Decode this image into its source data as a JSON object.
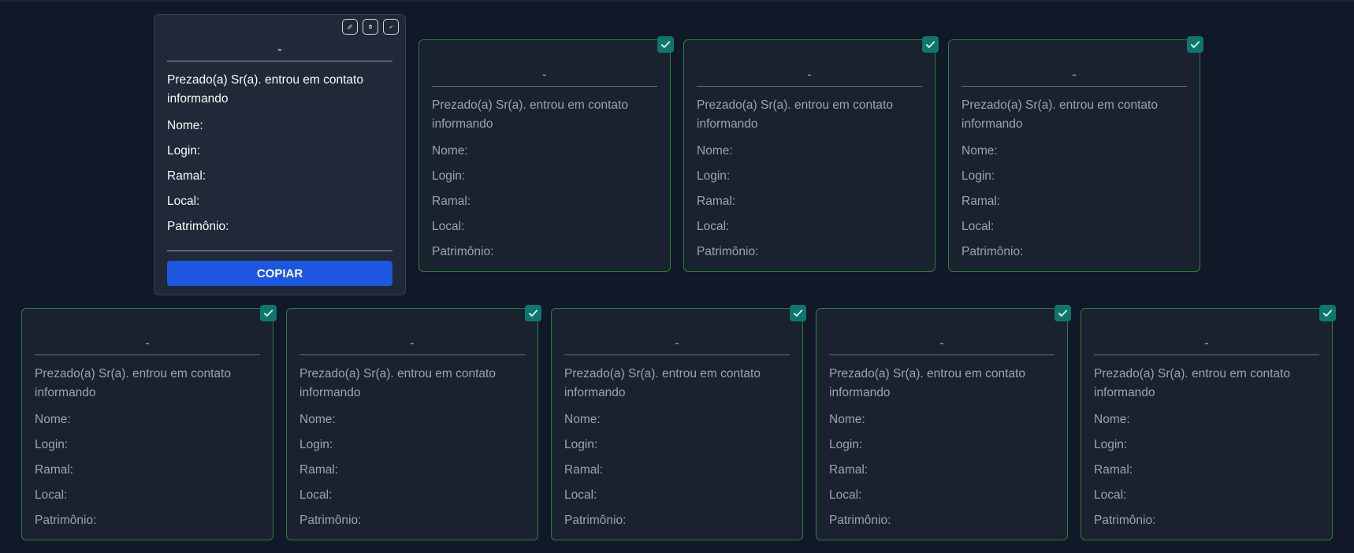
{
  "colors": {
    "background": "#111827",
    "card_active": "#1f2937",
    "card_done_border": "#2e7d32",
    "copy_button": "#1d56e0",
    "check_badge": "#0f766e"
  },
  "active_card": {
    "title": "-",
    "message": "Prezado(a) Sr(a). entrou em contato informando",
    "fields": [
      "Nome:",
      "Login:",
      "Ramal:",
      "Local:",
      "Patrimônio:"
    ],
    "copy_label": "COPIAR",
    "toolbar_icons": [
      "edit-icon",
      "trash-icon",
      "check-icon"
    ]
  },
  "done_cards": [
    {
      "title": "-",
      "message": "Prezado(a) Sr(a). entrou em contato informando",
      "fields": [
        "Nome:",
        "Login:",
        "Ramal:",
        "Local:",
        "Patrimônio:"
      ],
      "status": "checked"
    },
    {
      "title": "-",
      "message": "Prezado(a) Sr(a). entrou em contato informando",
      "fields": [
        "Nome:",
        "Login:",
        "Ramal:",
        "Local:",
        "Patrimônio:"
      ],
      "status": "checked"
    },
    {
      "title": "-",
      "message": "Prezado(a) Sr(a). entrou em contato informando",
      "fields": [
        "Nome:",
        "Login:",
        "Ramal:",
        "Local:",
        "Patrimônio:"
      ],
      "status": "checked"
    },
    {
      "title": "-",
      "message": "Prezado(a) Sr(a). entrou em contato informando",
      "fields": [
        "Nome:",
        "Login:",
        "Ramal:",
        "Local:",
        "Patrimônio:"
      ],
      "status": "checked"
    },
    {
      "title": "-",
      "message": "Prezado(a) Sr(a). entrou em contato informando",
      "fields": [
        "Nome:",
        "Login:",
        "Ramal:",
        "Local:",
        "Patrimônio:"
      ],
      "status": "checked"
    },
    {
      "title": "-",
      "message": "Prezado(a) Sr(a). entrou em contato informando",
      "fields": [
        "Nome:",
        "Login:",
        "Ramal:",
        "Local:",
        "Patrimônio:"
      ],
      "status": "checked"
    },
    {
      "title": "-",
      "message": "Prezado(a) Sr(a). entrou em contato informando",
      "fields": [
        "Nome:",
        "Login:",
        "Ramal:",
        "Local:",
        "Patrimônio:"
      ],
      "status": "checked"
    },
    {
      "title": "-",
      "message": "Prezado(a) Sr(a). entrou em contato informando",
      "fields": [
        "Nome:",
        "Login:",
        "Ramal:",
        "Local:",
        "Patrimônio:"
      ],
      "status": "checked"
    }
  ]
}
